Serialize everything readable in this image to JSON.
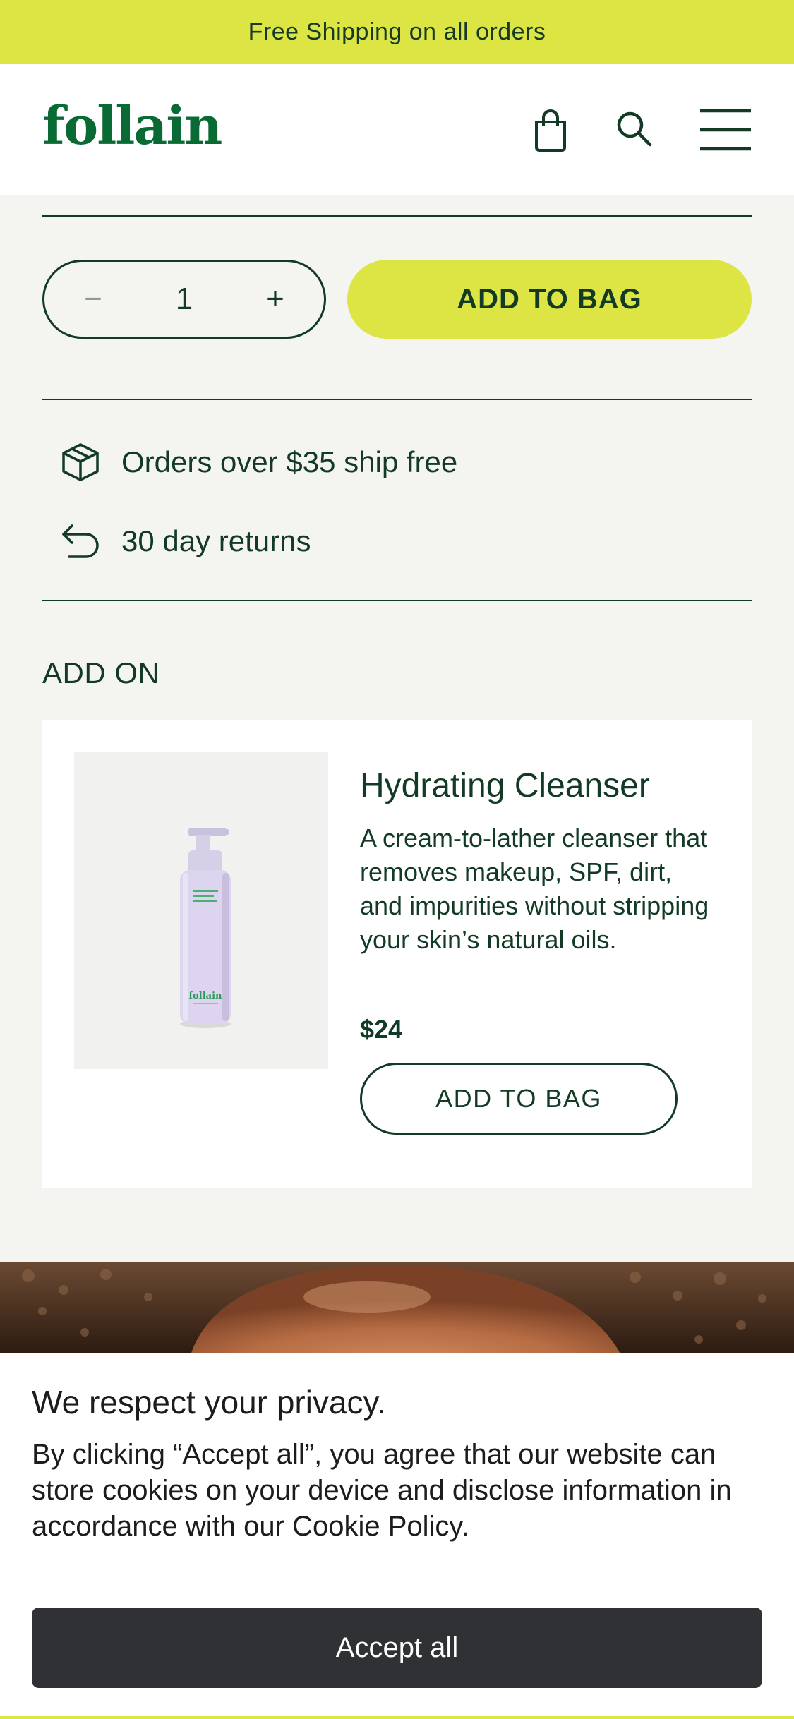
{
  "announcement": {
    "text": "Free Shipping on all orders"
  },
  "header": {
    "logo": "follain",
    "icons": [
      "bag-icon",
      "search-icon",
      "menu-icon"
    ]
  },
  "purchase": {
    "quantity": "1",
    "minus_label": "−",
    "plus_label": "+",
    "add_to_bag_label": "ADD TO BAG"
  },
  "perks": [
    {
      "icon": "box-icon",
      "text": "Orders over $35 ship free"
    },
    {
      "icon": "return-arrow-icon",
      "text": "30 day returns"
    }
  ],
  "addon": {
    "heading": "ADD ON",
    "product": {
      "bottle_brand": "follain",
      "title": "Hydrating Cleanser",
      "description": "A cream-to-lather cleanser that removes makeup, SPF, dirt, and impurities without stripping your skin’s natural oils.",
      "price": "$24",
      "button_label": "ADD TO BAG"
    }
  },
  "cookie_banner": {
    "title": "We respect your privacy.",
    "body": "By clicking “Accept all”, you agree that our website can store cookies on your device and disclose information in accordance with our Cookie Policy.",
    "accept_label": "Accept all"
  },
  "colors": {
    "accent_lime": "#dde544",
    "brand_green": "#0a6a34",
    "text_dark_green": "#123a24",
    "cookie_button": "#2f3135"
  }
}
